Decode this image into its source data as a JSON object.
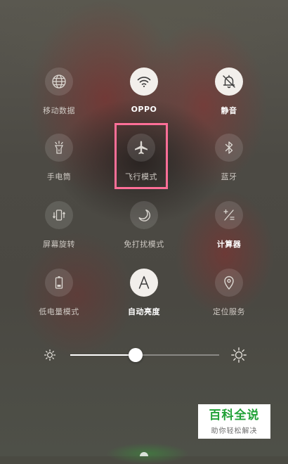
{
  "toggles": [
    {
      "id": "mobile-data",
      "label": "移动数据",
      "icon": "globe-icon",
      "active": false
    },
    {
      "id": "wifi",
      "label": "OPPO",
      "icon": "wifi-icon",
      "active": true
    },
    {
      "id": "mute",
      "label": "静音",
      "icon": "bell-muted-icon",
      "active": true
    },
    {
      "id": "flashlight",
      "label": "手电筒",
      "icon": "flashlight-icon",
      "active": false
    },
    {
      "id": "airplane",
      "label": "飞行模式",
      "icon": "airplane-icon",
      "active": false
    },
    {
      "id": "bluetooth",
      "label": "蓝牙",
      "icon": "bluetooth-icon",
      "active": false
    },
    {
      "id": "rotation",
      "label": "屏幕旋转",
      "icon": "screen-rotation-icon",
      "active": false
    },
    {
      "id": "dnd",
      "label": "免打扰模式",
      "icon": "moon-icon",
      "active": false
    },
    {
      "id": "calculator",
      "label": "计算器",
      "icon": "calculator-icon",
      "active": false,
      "label_bold": true
    },
    {
      "id": "power-saving",
      "label": "低电量模式",
      "icon": "battery-icon",
      "active": false
    },
    {
      "id": "auto-brightness",
      "label": "自动亮度",
      "icon": "letter-a-icon",
      "active": true
    },
    {
      "id": "location",
      "label": "定位服务",
      "icon": "location-pin-icon",
      "active": false
    }
  ],
  "brightness": {
    "level": 0.44,
    "low_icon": "sun-small-icon",
    "high_icon": "sun-large-icon"
  },
  "watermark": {
    "title": "百科全说",
    "subtitle": "助你轻松解决",
    "color": "#21a137"
  },
  "highlight_color": "#ff6f98"
}
